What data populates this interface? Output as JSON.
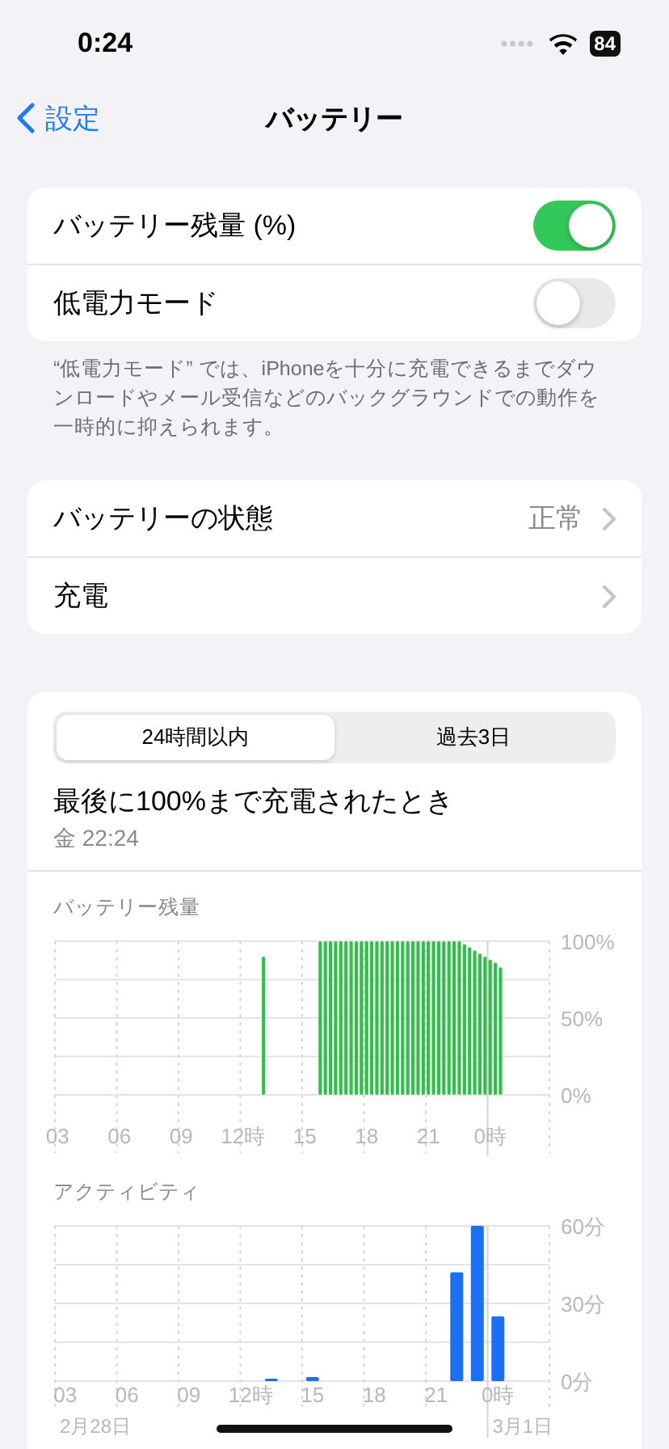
{
  "status_bar": {
    "time": "0:24",
    "battery": "84"
  },
  "nav": {
    "back": "設定",
    "title": "バッテリー"
  },
  "settings_group": [
    {
      "kind": "toggle",
      "label": "バッテリー残量 (%)",
      "on": true
    },
    {
      "kind": "toggle",
      "label": "低電力モード",
      "on": false
    }
  ],
  "footnote": "“低電力モード” では、iPhoneを十分に充電できるまでダウンロードやメール受信などのバックグラウンドでの動作を一時的に抑えられます。",
  "health_group": [
    {
      "kind": "link",
      "label": "バッテリーの状態",
      "value": "正常"
    },
    {
      "kind": "link",
      "label": "充電"
    }
  ],
  "usage": {
    "tabs": [
      {
        "label": "24時間以内",
        "selected": true
      },
      {
        "label": "過去3日",
        "selected": false
      }
    ],
    "last_charge_title": "最後に100%まで充電されたとき",
    "last_charge_time": "金 22:24",
    "battery_chart": {
      "chart_data": {
        "type": "bar",
        "grid": true,
        "title": "バッテリー残量",
        "ylim": [
          0,
          100
        ],
        "yticks": [
          {
            "value": 100,
            "label": "100%"
          },
          {
            "value": 50,
            "label": "50%"
          },
          {
            "value": 0,
            "label": "0%"
          }
        ],
        "categories": [
          "03",
          null,
          null,
          null,
          null,
          null,
          null,
          null,
          null,
          null,
          null,
          null,
          "06",
          null,
          null,
          null,
          null,
          null,
          null,
          null,
          null,
          null,
          null,
          null,
          "09",
          null,
          null,
          null,
          null,
          null,
          null,
          null,
          null,
          null,
          null,
          null,
          "12時",
          null,
          null,
          null,
          null,
          null,
          null,
          null,
          null,
          null,
          null,
          null,
          "15",
          null,
          null,
          null,
          null,
          null,
          null,
          null,
          null,
          null,
          null,
          null,
          "18",
          null,
          null,
          null,
          null,
          null,
          null,
          null,
          null,
          null,
          null,
          null,
          "21",
          null,
          null,
          null,
          null,
          null,
          null,
          null,
          null,
          null,
          null,
          null,
          "0時",
          null,
          null,
          null,
          null,
          null,
          null,
          null,
          null,
          null,
          null,
          null
        ],
        "series": [
          {
            "color": "#30c04a",
            "values": [
              null,
              null,
              null,
              null,
              null,
              null,
              null,
              null,
              null,
              null,
              null,
              null,
              null,
              null,
              null,
              null,
              null,
              null,
              null,
              null,
              null,
              null,
              null,
              null,
              null,
              null,
              null,
              null,
              null,
              null,
              null,
              null,
              null,
              null,
              null,
              null,
              null,
              null,
              null,
              null,
              90,
              null,
              null,
              null,
              null,
              null,
              null,
              null,
              null,
              null,
              null,
              100,
              100,
              100,
              100,
              100,
              100,
              100,
              100,
              100,
              100,
              100,
              100,
              100,
              100,
              100,
              100,
              100,
              100,
              100,
              100,
              100,
              100,
              100,
              100,
              100,
              100,
              100,
              100,
              98,
              96,
              94,
              92,
              90,
              88,
              86,
              83,
              null,
              null,
              null,
              null,
              null,
              null,
              null,
              null,
              null
            ]
          }
        ]
      }
    },
    "activity_chart": {
      "chart_data": {
        "type": "bar",
        "grid": true,
        "title": "アクティビティ",
        "ylim": [
          0,
          60
        ],
        "yticks": [
          {
            "value": 60,
            "label": "60分"
          },
          {
            "value": 30,
            "label": "30分"
          },
          {
            "value": 0,
            "label": "0分"
          }
        ],
        "categories": [
          "03",
          null,
          null,
          "06",
          null,
          null,
          "09",
          null,
          null,
          "12時",
          null,
          null,
          "15",
          null,
          null,
          "18",
          null,
          null,
          "21",
          null,
          null,
          "0時",
          null,
          null
        ],
        "series": [
          {
            "color": "#1a6ff5",
            "values": [
              0,
              0,
              0,
              0,
              0,
              0,
              0,
              0,
              0,
              0,
              0.8,
              0,
              1.6,
              0,
              0,
              0,
              0,
              0,
              0,
              42,
              60,
              25,
              0,
              0
            ]
          }
        ]
      },
      "date_labels": [
        "2月28日",
        "3月1日"
      ]
    }
  }
}
